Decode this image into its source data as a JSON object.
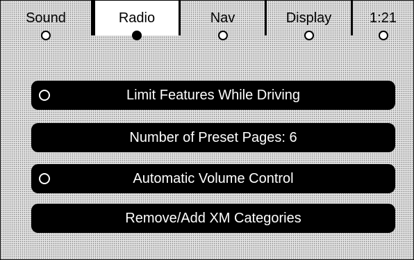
{
  "tabs": [
    {
      "label": "Sound",
      "selected": false
    },
    {
      "label": "Radio",
      "selected": true
    },
    {
      "label": "Nav",
      "selected": false
    },
    {
      "label": "Display",
      "selected": false
    },
    {
      "label": "1:21",
      "selected": false
    }
  ],
  "menu": {
    "items": [
      {
        "label": "Limit Features While Driving",
        "has_radio": true,
        "radio_checked": false
      },
      {
        "label": "Number of Preset Pages: 6",
        "has_radio": false
      },
      {
        "label": "Automatic Volume Control",
        "has_radio": true,
        "radio_checked": false
      },
      {
        "label": "Remove/Add XM Categories",
        "has_radio": false
      }
    ]
  },
  "colors": {
    "button_bg": "#000000",
    "button_text": "#ffffff",
    "screen_bg": "#e2e2e2",
    "selected_tab_bg": "#ffffff"
  }
}
